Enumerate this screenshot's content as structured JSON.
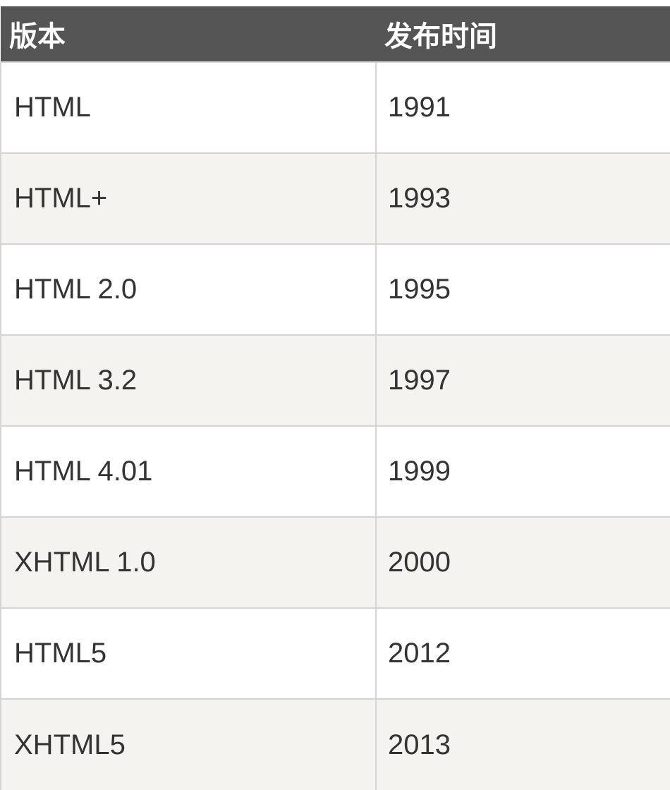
{
  "table": {
    "headers": [
      "版本",
      "发布时间"
    ],
    "rows": [
      {
        "version": "HTML",
        "year": "1991"
      },
      {
        "version": "HTML+",
        "year": "1993"
      },
      {
        "version": "HTML 2.0",
        "year": "1995"
      },
      {
        "version": "HTML 3.2",
        "year": "1997"
      },
      {
        "version": "HTML 4.01",
        "year": "1999"
      },
      {
        "version": "XHTML 1.0",
        "year": "2000"
      },
      {
        "version": "HTML5",
        "year": "2012"
      },
      {
        "version": "XHTML5",
        "year": "2013"
      }
    ]
  },
  "colors": {
    "header_bg": "#555555",
    "header_text": "#ffffff",
    "row_alt_bg": "#f4f3f0",
    "row_bg": "#ffffff",
    "border": "#d4d4d4",
    "cell_text": "#333333"
  }
}
